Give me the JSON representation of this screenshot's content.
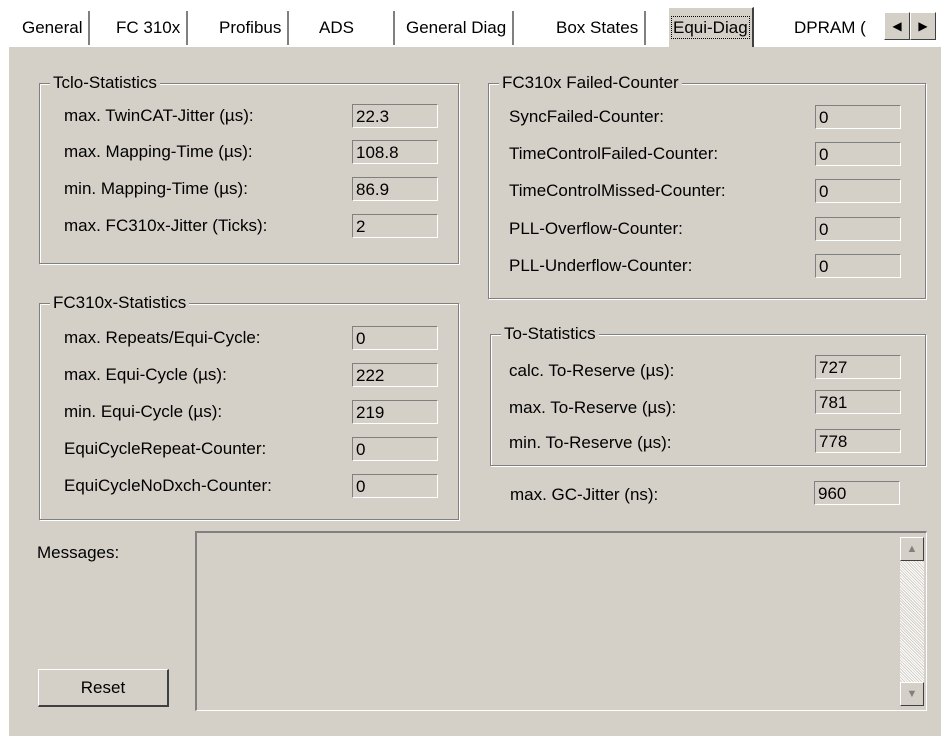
{
  "tabs": [
    {
      "label": "General"
    },
    {
      "label": "FC 310x"
    },
    {
      "label": "Profibus"
    },
    {
      "label": "ADS"
    },
    {
      "label": "General Diag"
    },
    {
      "label": "Box States"
    },
    {
      "label": "Equi-Diag"
    },
    {
      "label": "DPRAM ("
    }
  ],
  "tab_arrows": {
    "left": "◀",
    "right": "▶"
  },
  "tcio": {
    "title": "Tclo-Statistics",
    "rows": [
      {
        "label": "max. TwinCAT-Jitter (µs):",
        "value": "22.3"
      },
      {
        "label": "max. Mapping-Time (µs):",
        "value": "108.8"
      },
      {
        "label": "min. Mapping-Time (µs):",
        "value": "86.9"
      },
      {
        "label": "max. FC310x-Jitter (Ticks):",
        "value": "2"
      }
    ]
  },
  "fc310x_stats": {
    "title": "FC310x-Statistics",
    "rows": [
      {
        "label": "max. Repeats/Equi-Cycle:",
        "value": "0"
      },
      {
        "label": "max. Equi-Cycle (µs):",
        "value": "222"
      },
      {
        "label": "min. Equi-Cycle (µs):",
        "value": "219"
      },
      {
        "label": "EquiCycleRepeat-Counter:",
        "value": "0"
      },
      {
        "label": "EquiCycleNoDxch-Counter:",
        "value": "0"
      }
    ]
  },
  "failed_counter": {
    "title": "FC310x Failed-Counter",
    "rows": [
      {
        "label": "SyncFailed-Counter:",
        "value": "0"
      },
      {
        "label": "TimeControlFailed-Counter:",
        "value": "0"
      },
      {
        "label": "TimeControlMissed-Counter:",
        "value": "0"
      },
      {
        "label": "PLL-Overflow-Counter:",
        "value": "0"
      },
      {
        "label": "PLL-Underflow-Counter:",
        "value": "0"
      }
    ]
  },
  "to_stats": {
    "title": "To-Statistics",
    "rows": [
      {
        "label": "calc. To-Reserve (µs):",
        "value": "727"
      },
      {
        "label": "max. To-Reserve (µs):",
        "value": "781"
      },
      {
        "label": "min. To-Reserve (µs):",
        "value": "778"
      }
    ]
  },
  "gc_jitter": {
    "label": "max. GC-Jitter (ns):",
    "value": "960"
  },
  "messages": {
    "label": "Messages:",
    "content": ""
  },
  "reset_label": "Reset",
  "scroll_arrows": {
    "up": "▲",
    "down": "▼"
  },
  "colors": {
    "face": "#d4d0c8",
    "shadow": "#808080",
    "highlight": "#ffffff"
  }
}
